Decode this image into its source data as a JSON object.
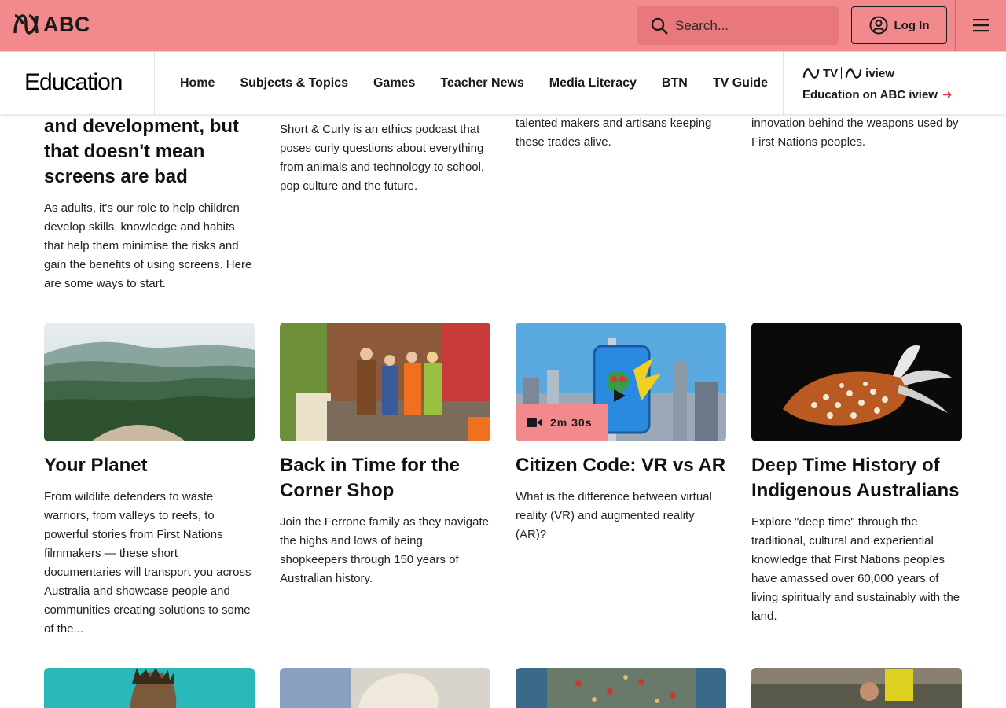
{
  "header": {
    "logo_text": "ABC",
    "search_placeholder": "Search...",
    "login_label": "Log In"
  },
  "section_nav": {
    "brand": "Education",
    "links": [
      "Home",
      "Subjects & Topics",
      "Games",
      "Teacher News",
      "Media Literacy",
      "BTN",
      "TV Guide"
    ],
    "iview": {
      "tv_label": "TV",
      "iview_label": "iview",
      "cta": "Education on ABC iview"
    }
  },
  "top_row": [
    {
      "title_lines": [
        "and development, but",
        "that doesn't mean",
        "screens are bad"
      ],
      "desc": "As adults, it's our role to help children develop skills, knowledge and habits that help them minimise the risks and gain the benefits of using screens. Here are some ways to start."
    },
    {
      "desc": "Short & Curly is an ethics podcast that poses curly questions about everything from animals and technology to school, pop culture and the future."
    },
    {
      "desc": "talented makers and artisans keeping these trades alive."
    },
    {
      "desc": "innovation behind the weapons used by First Nations peoples."
    }
  ],
  "cards": [
    {
      "title": "Your Planet",
      "desc": "From wildlife defenders to waste warriors, from valleys to reefs, to powerful stories from First Nations filmmakers — these short documentaries will transport you across Australia and showcase people and communities creating solutions to some of the..."
    },
    {
      "title": "Back in Time for the Corner Shop",
      "desc": "Join the Ferrone family as they navigate the highs and lows of being shopkeepers through 150 years of Australian history."
    },
    {
      "title": "Citizen Code: VR vs AR",
      "desc": "What is the difference between virtual reality (VR) and augmented reality (AR)?",
      "duration": "2m 30s"
    },
    {
      "title": "Deep Time History of Indigenous Australians",
      "desc": "Explore \"deep time\" through the traditional, cultural and experiential knowledge that First Nations peoples have amassed over 60,000 years of living spiritually and sustainably with the land."
    }
  ],
  "colors": {
    "topbar": "#f28a8d",
    "search_bg": "#e9787c",
    "accent_arrow": "#e0314b"
  },
  "icons": [
    "abc-logo-icon",
    "search-icon",
    "user-icon",
    "menu-icon",
    "video-icon",
    "arrow-right-icon"
  ]
}
